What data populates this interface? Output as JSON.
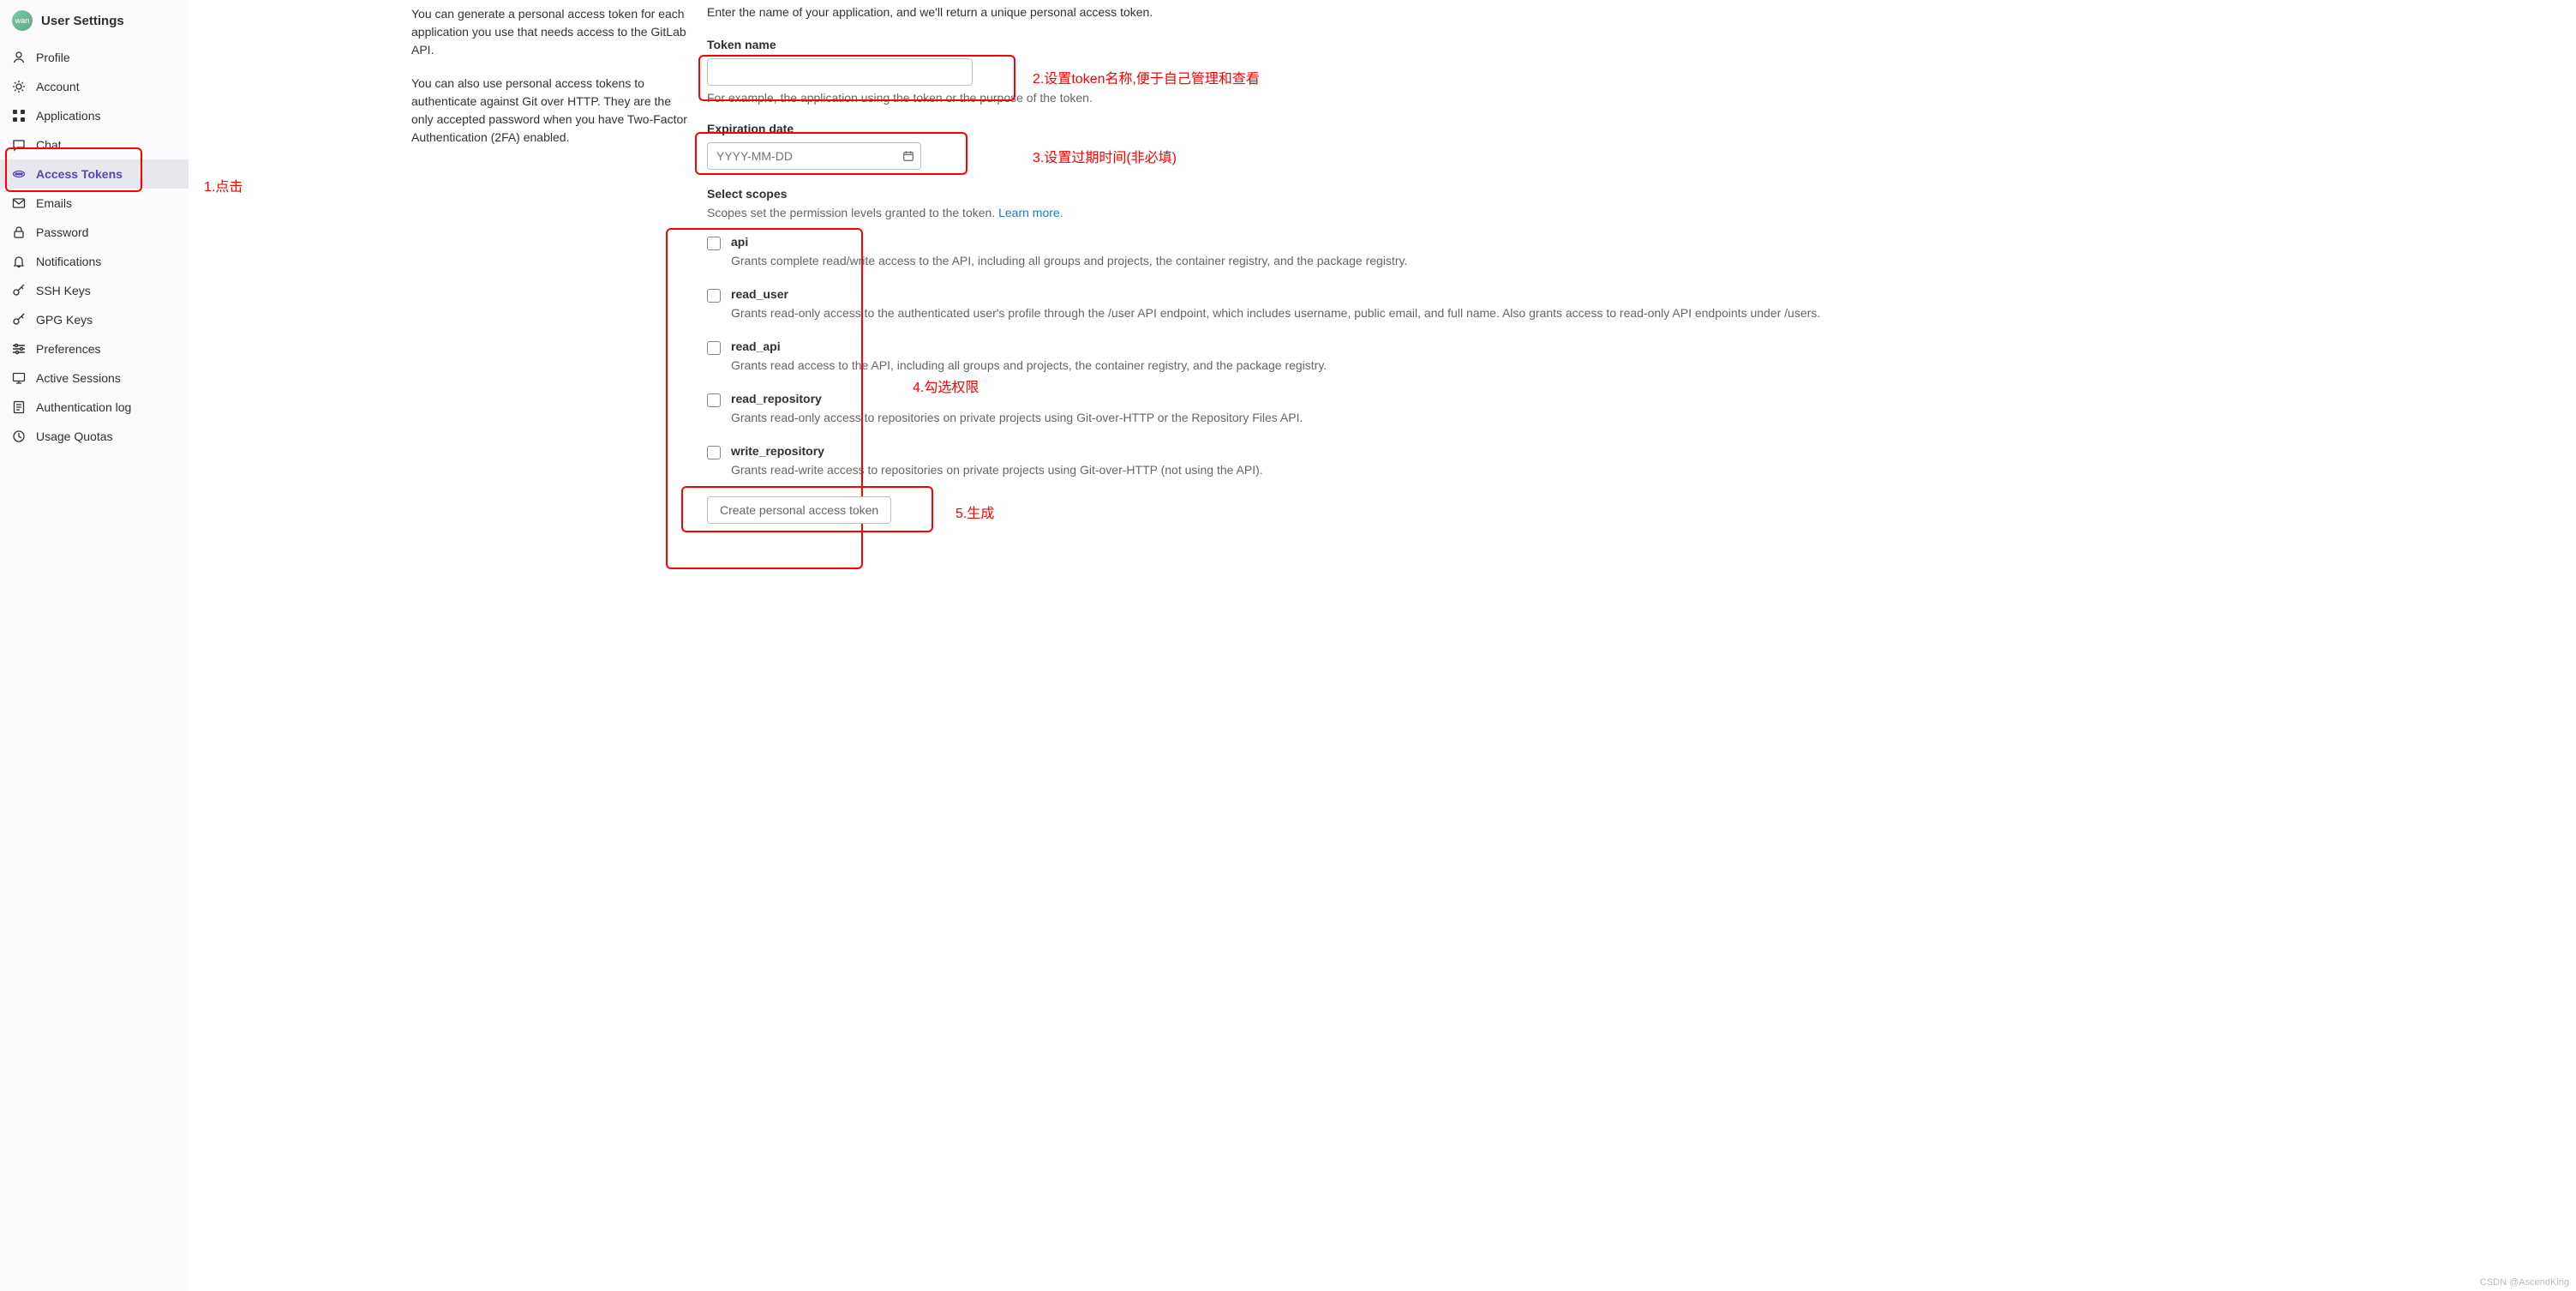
{
  "sidebar": {
    "title": "User Settings",
    "avatar_text": "wan",
    "items": [
      {
        "label": "Profile",
        "icon": "profile",
        "active": false
      },
      {
        "label": "Account",
        "icon": "account",
        "active": false
      },
      {
        "label": "Applications",
        "icon": "applications",
        "active": false
      },
      {
        "label": "Chat",
        "icon": "chat",
        "active": false
      },
      {
        "label": "Access Tokens",
        "icon": "token",
        "active": true
      },
      {
        "label": "Emails",
        "icon": "email",
        "active": false
      },
      {
        "label": "Password",
        "icon": "lock",
        "active": false
      },
      {
        "label": "Notifications",
        "icon": "bell",
        "active": false
      },
      {
        "label": "SSH Keys",
        "icon": "key",
        "active": false
      },
      {
        "label": "GPG Keys",
        "icon": "key",
        "active": false
      },
      {
        "label": "Preferences",
        "icon": "preferences",
        "active": false
      },
      {
        "label": "Active Sessions",
        "icon": "sessions",
        "active": false
      },
      {
        "label": "Authentication log",
        "icon": "log",
        "active": false
      },
      {
        "label": "Usage Quotas",
        "icon": "quota",
        "active": false
      }
    ]
  },
  "left": {
    "p1": "You can generate a personal access token for each application you use that needs access to the GitLab API.",
    "p2": "You can also use personal access tokens to authenticate against Git over HTTP. They are the only accepted password when you have Two-Factor Authentication (2FA) enabled."
  },
  "form": {
    "intro": "Enter the name of your application, and we'll return a unique personal access token.",
    "token_name_label": "Token name",
    "token_name_value": "",
    "token_name_hint": "For example, the application using the token or the purpose of the token.",
    "expiration_label": "Expiration date",
    "expiration_placeholder": "YYYY-MM-DD",
    "scopes_title": "Select scopes",
    "scopes_hint": "Scopes set the permission levels granted to the token. ",
    "learn_more": "Learn more.",
    "create_button": "Create personal access token"
  },
  "scopes": [
    {
      "name": "api",
      "desc": "Grants complete read/write access to the API, including all groups and projects, the container registry, and the package registry."
    },
    {
      "name": "read_user",
      "desc": "Grants read-only access to the authenticated user's profile through the /user API endpoint, which includes username, public email, and full name. Also grants access to read-only API endpoints under /users."
    },
    {
      "name": "read_api",
      "desc": "Grants read access to the API, including all groups and projects, the container registry, and the package registry."
    },
    {
      "name": "read_repository",
      "desc": "Grants read-only access to repositories on private projects using Git-over-HTTP or the Repository Files API."
    },
    {
      "name": "write_repository",
      "desc": "Grants read-write access to repositories on private projects using Git-over-HTTP (not using the API)."
    }
  ],
  "annotations": {
    "a1": "1.点击",
    "a2": "2.设置token名称,便于自己管理和查看",
    "a3": "3.设置过期时间(非必填)",
    "a4": "4.勾选权限",
    "a5": "5.生成"
  },
  "watermark": "CSDN @AscendKing"
}
